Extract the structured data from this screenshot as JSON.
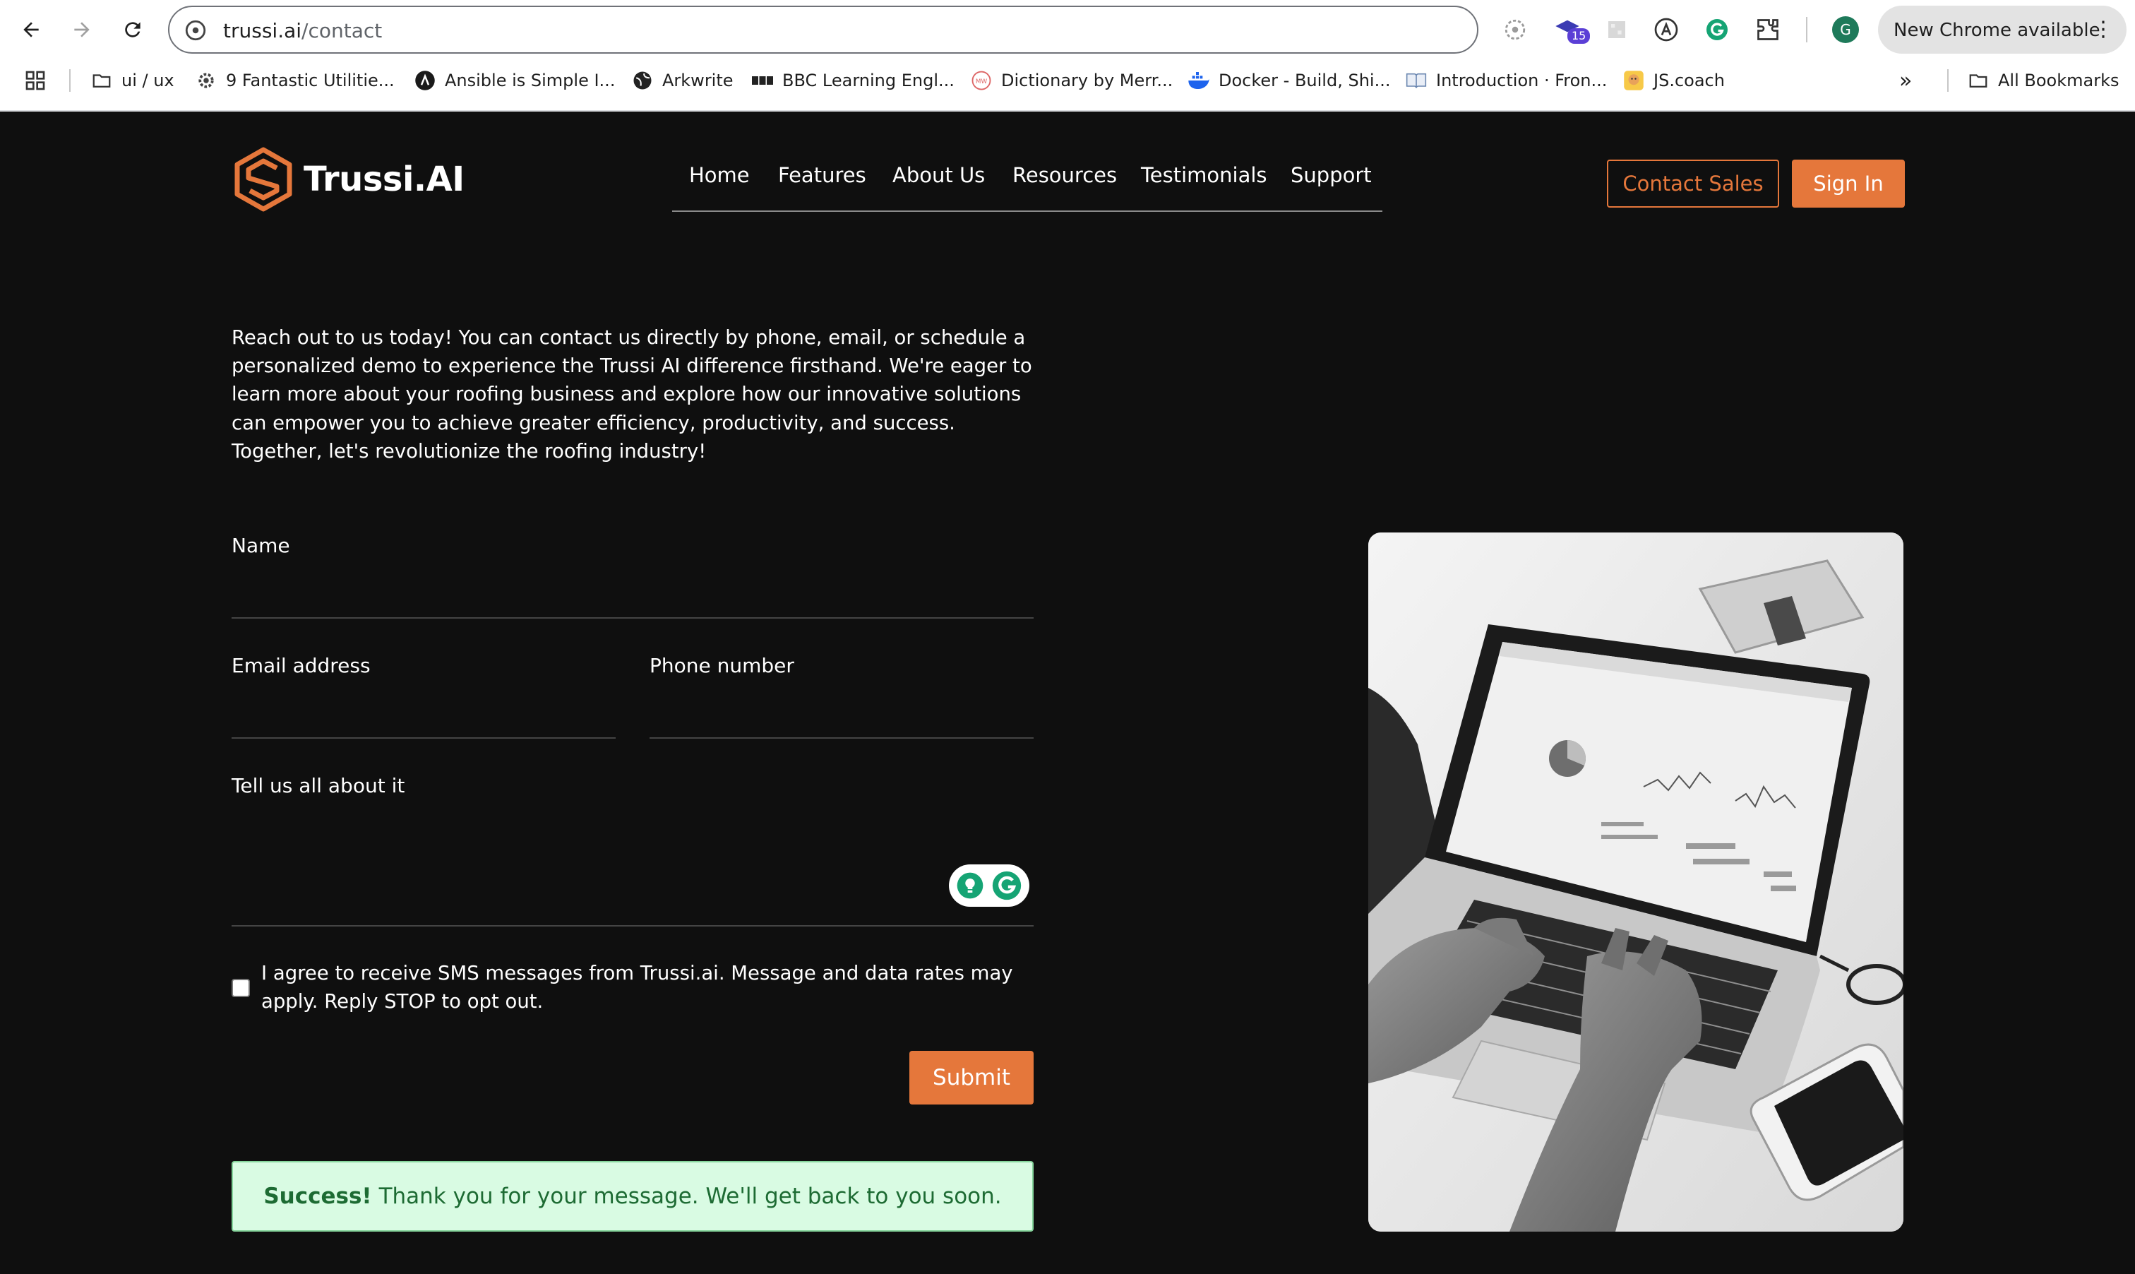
{
  "browser": {
    "url_host": "trussi.ai",
    "url_path": "/contact",
    "extension_badge": "15",
    "profile_initial": "G",
    "new_chrome_label": "New Chrome available",
    "bookmarks": [
      {
        "label": "ui / ux",
        "icon": "folder-icon"
      },
      {
        "label": "9 Fantastic Utilitie...",
        "icon": "gear-icon"
      },
      {
        "label": "Ansible is Simple I...",
        "icon": "ansible-icon"
      },
      {
        "label": "Arkwrite",
        "icon": "globe-icon"
      },
      {
        "label": "BBC Learning Engl...",
        "icon": "bbc-icon"
      },
      {
        "label": "Dictionary by Merr...",
        "icon": "mw-icon"
      },
      {
        "label": "Docker - Build, Shi...",
        "icon": "docker-icon"
      },
      {
        "label": "Introduction · Fron...",
        "icon": "book-icon"
      },
      {
        "label": "JS.coach",
        "icon": "jscoach-icon"
      }
    ],
    "overflow_label": "»",
    "all_bookmarks_label": "All Bookmarks"
  },
  "header": {
    "brand": "Trussi.AI",
    "nav": [
      "Home",
      "Features",
      "About Us",
      "Resources",
      "Testimonials",
      "Support"
    ],
    "contact_sales": "Contact Sales",
    "sign_in": "Sign In"
  },
  "intro": "Reach out to us today! You can contact us directly by phone, email, or schedule a personalized demo to experience the Trussi AI difference firsthand. We're eager to learn more about your roofing business and explore how our innovative solutions can empower you to achieve greater efficiency, productivity, and success. Together, let's revolutionize the roofing industry!",
  "form": {
    "name_label": "Name",
    "name_value": "",
    "email_label": "Email address",
    "email_value": "",
    "phone_label": "Phone number",
    "phone_value": "",
    "message_label": "Tell us all about it",
    "message_value": "",
    "sms_consent": "I agree to receive SMS messages from Trussi.ai. Message and data rates may apply. Reply STOP to opt out.",
    "sms_checked": false,
    "submit": "Submit"
  },
  "success": {
    "strong": "Success!",
    "text": "Thank you for your message. We'll get back to you soon."
  },
  "colors": {
    "accent": "#e5773b",
    "page_bg": "#0f0f0f",
    "success_bg": "#d9fbe3",
    "success_text": "#1d6b33"
  }
}
